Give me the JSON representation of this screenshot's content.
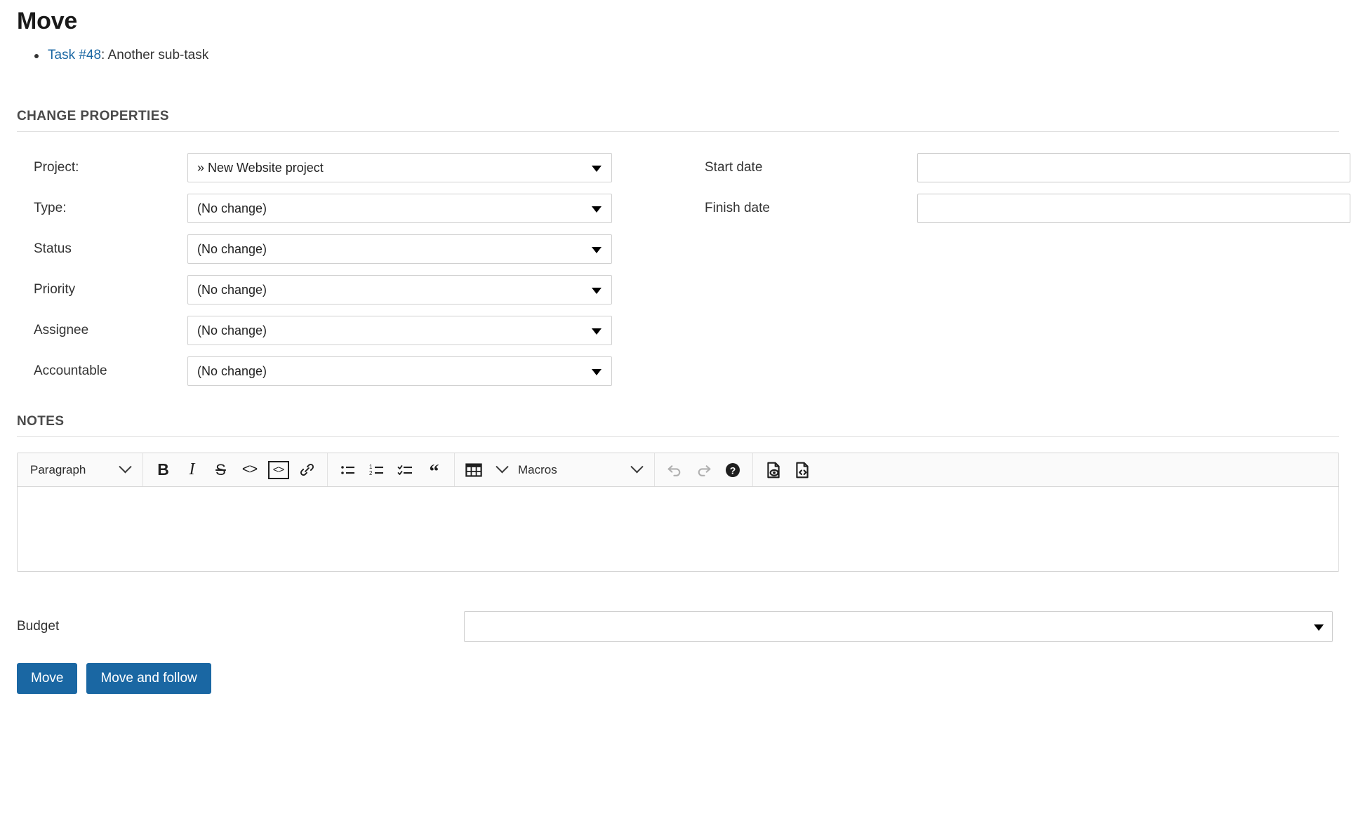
{
  "header": {
    "title": "Move"
  },
  "task_list": {
    "items": [
      {
        "link_text": "Task #48",
        "rest": ": Another sub-task"
      }
    ]
  },
  "sections": {
    "change_properties_heading": "CHANGE PROPERTIES",
    "notes_heading": "NOTES"
  },
  "change_properties": {
    "left_fields": [
      {
        "label": "Project:",
        "value": "» New Website project"
      },
      {
        "label": "Type:",
        "value": "(No change)"
      },
      {
        "label": "Status",
        "value": "(No change)"
      },
      {
        "label": "Priority",
        "value": "(No change)"
      },
      {
        "label": "Assignee",
        "value": "(No change)"
      },
      {
        "label": "Accountable",
        "value": "(No change)"
      }
    ],
    "right_fields": [
      {
        "label": "Start date",
        "value": "",
        "placeholder": ""
      },
      {
        "label": "Finish date",
        "value": "",
        "placeholder": ""
      }
    ]
  },
  "editor": {
    "block_type": "Paragraph",
    "macros": "Macros",
    "content": "",
    "buttons": [
      {
        "name": "bold-button",
        "glyph": "B"
      },
      {
        "name": "italic-button",
        "glyph": "I"
      },
      {
        "name": "strikethrough-button",
        "glyph": "S"
      },
      {
        "name": "inline-code-button",
        "glyph": "<>"
      },
      {
        "name": "code-block-button",
        "glyph": "<>"
      },
      {
        "name": "link-button",
        "glyph": "link"
      },
      {
        "name": "bulleted-list-button",
        "glyph": "bullets"
      },
      {
        "name": "numbered-list-button",
        "glyph": "numbers"
      },
      {
        "name": "task-list-button",
        "glyph": "checks"
      },
      {
        "name": "blockquote-button",
        "glyph": "“"
      },
      {
        "name": "table-button",
        "glyph": "table"
      },
      {
        "name": "undo-button",
        "glyph": "undo"
      },
      {
        "name": "redo-button",
        "glyph": "redo"
      },
      {
        "name": "help-button",
        "glyph": "?"
      },
      {
        "name": "preview-button",
        "glyph": "preview"
      },
      {
        "name": "source-view-button",
        "glyph": "source"
      }
    ]
  },
  "budget": {
    "label": "Budget",
    "value": ""
  },
  "actions": {
    "move": "Move",
    "move_and_follow": "Move and follow"
  },
  "colors": {
    "accent": "#1a67a3",
    "link": "#1a67a3",
    "border": "#d0d0d0",
    "heading": "#4a4a4a"
  }
}
